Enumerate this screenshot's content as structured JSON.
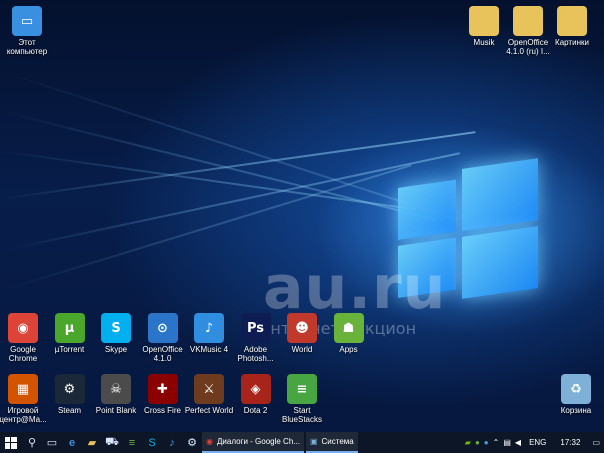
{
  "desktop": {
    "watermark": "au.ru",
    "watermark_sub": "интернет-аукцион",
    "top_left_icons": [
      {
        "name": "this-pc",
        "label": "Этот компьютер",
        "color": "#3a90e0",
        "glyph": "▭",
        "icon": "computer-icon"
      }
    ],
    "top_right_icons": [
      {
        "name": "musik",
        "label": "Musik",
        "color": "#e8c25a",
        "glyph": "",
        "icon": "folder-icon"
      },
      {
        "name": "openoffice-folder",
        "label": "OpenOffice 4.1.0 (ru) I...",
        "color": "#e8c25a",
        "glyph": "",
        "icon": "folder-icon"
      },
      {
        "name": "kartinki",
        "label": "Картинки",
        "color": "#e8c25a",
        "glyph": "",
        "icon": "folder-icon"
      }
    ],
    "row1_icons": [
      {
        "name": "google-chrome",
        "label": "Google Chrome",
        "color": "#db4437",
        "glyph": "◉",
        "icon": "chrome-icon"
      },
      {
        "name": "utorrent",
        "label": "µTorrent",
        "color": "#4aa72c",
        "glyph": "µ",
        "icon": "utorrent-icon"
      },
      {
        "name": "skype",
        "label": "Skype",
        "color": "#00aff0",
        "glyph": "S",
        "icon": "skype-icon"
      },
      {
        "name": "openoffice",
        "label": "OpenOffice 4.1.0",
        "color": "#2a75c9",
        "glyph": "⊙",
        "icon": "openoffice-icon"
      },
      {
        "name": "vkmusic",
        "label": "VKMusic 4",
        "color": "#2f8ee0",
        "glyph": "♪",
        "icon": "vkmusic-icon"
      },
      {
        "name": "photoshop",
        "label": "Adobe Photosh...",
        "color": "#0e1c54",
        "glyph": "Ps",
        "icon": "photoshop-icon"
      },
      {
        "name": "world",
        "label": "World",
        "color": "#c0392b",
        "glyph": "☻",
        "icon": "world-icon"
      },
      {
        "name": "apps",
        "label": "Apps",
        "color": "#6ab33a",
        "glyph": "☗",
        "icon": "apps-icon"
      }
    ],
    "row2_icons": [
      {
        "name": "game-center",
        "label": "Игровой центр@Ma...",
        "color": "#d35400",
        "glyph": "▦",
        "icon": "game-center-icon"
      },
      {
        "name": "steam",
        "label": "Steam",
        "color": "#1b2838",
        "glyph": "⚙",
        "icon": "steam-icon"
      },
      {
        "name": "point-blank",
        "label": "Point Blank",
        "color": "#4b4b4b",
        "glyph": "☠",
        "icon": "point-blank-icon"
      },
      {
        "name": "cross-fire",
        "label": "Cross Fire",
        "color": "#8b0000",
        "glyph": "✚",
        "icon": "crossfire-icon"
      },
      {
        "name": "perfect-world",
        "label": "Perfect World",
        "color": "#6e3b1e",
        "glyph": "⚔",
        "icon": "perfect-world-icon"
      },
      {
        "name": "dota2",
        "label": "Dota 2",
        "color": "#a8231a",
        "glyph": "◈",
        "icon": "dota2-icon"
      },
      {
        "name": "bluestacks",
        "label": "Start BlueStacks",
        "color": "#47a641",
        "glyph": "≡",
        "icon": "bluestacks-icon"
      }
    ],
    "recycle_bin": {
      "label": "Корзина",
      "icon": "recycle-bin-icon",
      "color": "#7fb0d8"
    }
  },
  "taskbar": {
    "start_icon": "windows-start-icon",
    "search_icon": "search-icon",
    "task_view_icon": "task-view-icon",
    "pinned": [
      "edge-icon",
      "explorer-icon",
      "store-icon",
      "bluestacks-icon",
      "skype-icon",
      "vkmusic-icon",
      "steam-icon",
      "chrome-icon"
    ],
    "tasks": [
      {
        "label": "Диалоги - Google Ch...",
        "icon": "chrome-icon"
      },
      {
        "label": "Система",
        "icon": "system-icon"
      }
    ],
    "tray": {
      "lang": "ENG",
      "time": "17:32"
    }
  }
}
